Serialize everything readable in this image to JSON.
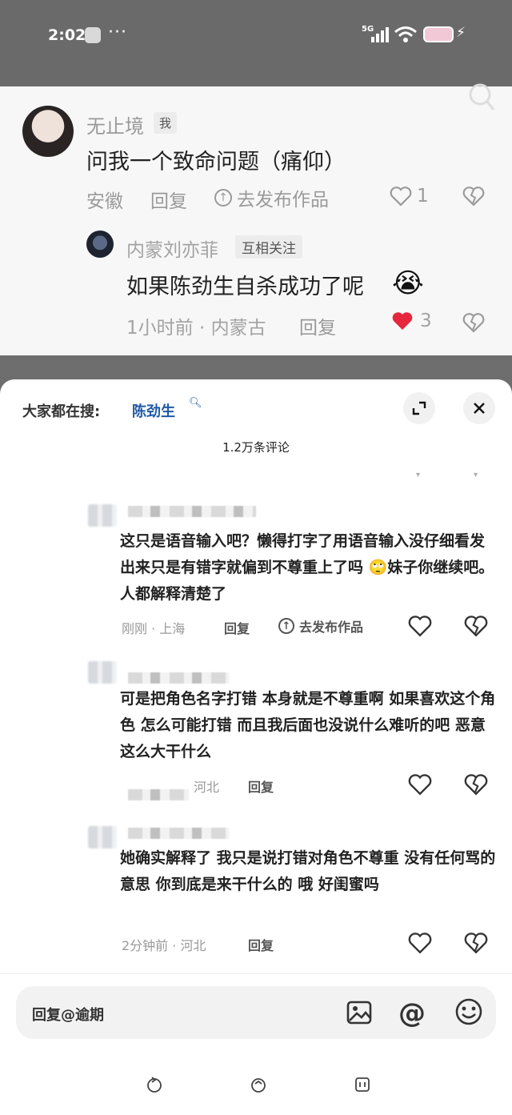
{
  "status_bar": {
    "time": "2:02",
    "dots": "···",
    "network": "5G"
  },
  "post": {
    "author": {
      "name": "无止境",
      "badge": "我"
    },
    "text": "问我一个致命问题（痛仰）",
    "location": "安徽",
    "reply_label": "回复",
    "publish_label": "去发布作品",
    "likes": "1",
    "reply": {
      "author": {
        "name": "内蒙刘亦菲",
        "badge": "互相关注"
      },
      "text": "如果陈劲生自杀成功了呢",
      "emoji": "😭",
      "meta": "1小时前 · 内蒙古",
      "reply_label": "回复",
      "likes": "3"
    }
  },
  "sheet": {
    "search_label": "大家都在搜:",
    "search_term": "陈劲生",
    "comment_count": "1.2万条评论",
    "comments": [
      {
        "text": "这只是语音输入吧？懒得打字了用语音输入没仔细看发出来只是有错字就偏到不尊重上了吗 🙄妹子你继续吧。人都解释清楚了",
        "meta": "刚刚 · 上海",
        "reply_label": "回复",
        "publish_label": "去发布作品"
      },
      {
        "text": "可是把角色名字打错 本身就是不尊重啊 如果喜欢这个角色 怎么可能打错 而且我后面也没说什么难听的吧 恶意这么大干什么",
        "meta": "河北",
        "reply_label": "回复"
      },
      {
        "text": "她确实解释了 我只是说打错对角色不尊重 没有任何骂的意思 你到底是来干什么的 哦 好闺蜜吗",
        "meta": "2分钟前 · 河北",
        "reply_label": "回复"
      }
    ],
    "input_placeholder": "回复@逾期"
  },
  "colors": {
    "accent_link": "#1f5aa6",
    "like_red": "#e6263c"
  }
}
